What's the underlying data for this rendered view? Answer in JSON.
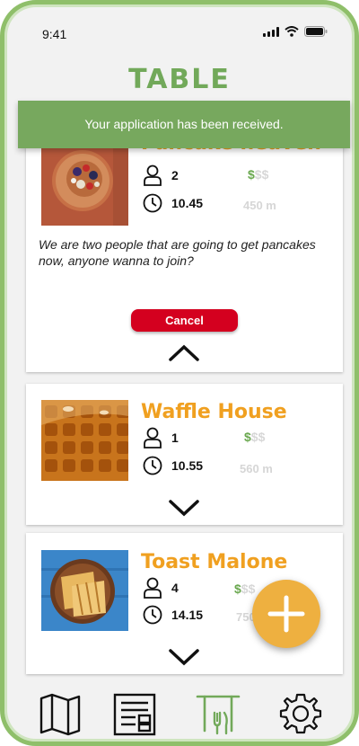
{
  "status_bar": {
    "time": "9:41"
  },
  "app": {
    "title": "TABLE"
  },
  "toast": {
    "message": "Your application has been received."
  },
  "cards": [
    {
      "name": "Pancake heaven",
      "people": "2",
      "time": "10.45",
      "price_active": "$",
      "price_inactive": "$$",
      "distance": "450 m",
      "description": "We are two people that are going to get pancakes now, anyone wanna to join?",
      "cancel_label": "Cancel",
      "expanded": true
    },
    {
      "name": "Waffle House",
      "people": "1",
      "time": "10.55",
      "price_active": "$",
      "price_inactive": "$$",
      "distance": "560 m",
      "expanded": false
    },
    {
      "name": "Toast Malone",
      "people": "4",
      "time": "14.15",
      "price_active": "$",
      "price_inactive": "$$",
      "distance": "750 m",
      "expanded": false
    }
  ],
  "colors": {
    "accent_green": "#72a95a",
    "title_orange": "#f0a020",
    "cancel_red": "#d4001f",
    "fab_yellow": "#eeb040"
  },
  "icons": {
    "people": "person-icon",
    "time": "clock-icon",
    "nav": [
      "map-icon",
      "list-icon",
      "fork-knife-icon",
      "gear-icon"
    ]
  }
}
